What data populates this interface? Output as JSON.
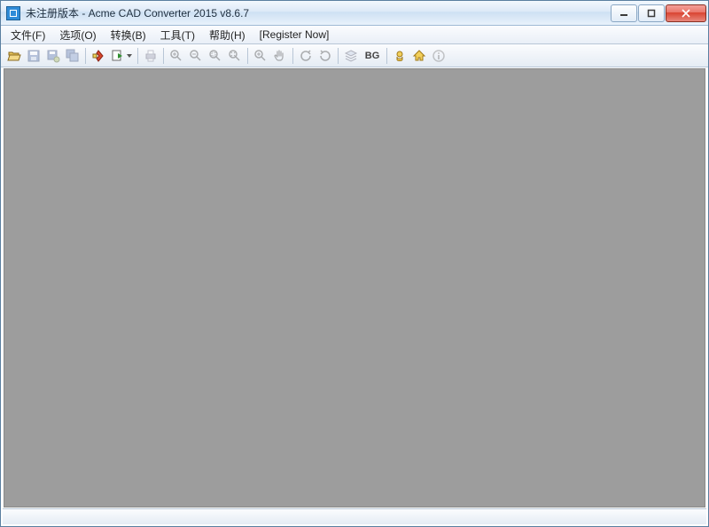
{
  "window": {
    "title": "未注册版本 - Acme CAD Converter 2015 v8.6.7"
  },
  "menu": {
    "file": "文件(F)",
    "options": "选项(O)",
    "convert": "转换(B)",
    "tools": "工具(T)",
    "help": "帮助(H)",
    "register": "[Register Now]"
  },
  "toolbar": {
    "open": "open-icon",
    "save": "save-icon",
    "save_as": "save-as-icon",
    "batch_save": "batch-save-icon",
    "convert": "convert-icon",
    "export": "export-icon",
    "print": "print-icon",
    "zoom_in": "zoom-in-icon",
    "zoom_out": "zoom-out-icon",
    "zoom_window": "zoom-window-icon",
    "zoom_extents": "zoom-extents-icon",
    "zoom_realtime": "zoom-realtime-icon",
    "pan": "pan-icon",
    "rotate_left": "rotate-left-icon",
    "rotate_right": "rotate-right-icon",
    "layers": "layers-icon",
    "bg_label": "BG",
    "options": "options-icon",
    "home": "home-icon",
    "info": "info-icon"
  },
  "colors": {
    "accent": "#2e8bd8",
    "workspace_bg": "#9d9d9d",
    "close_red": "#d94330"
  }
}
